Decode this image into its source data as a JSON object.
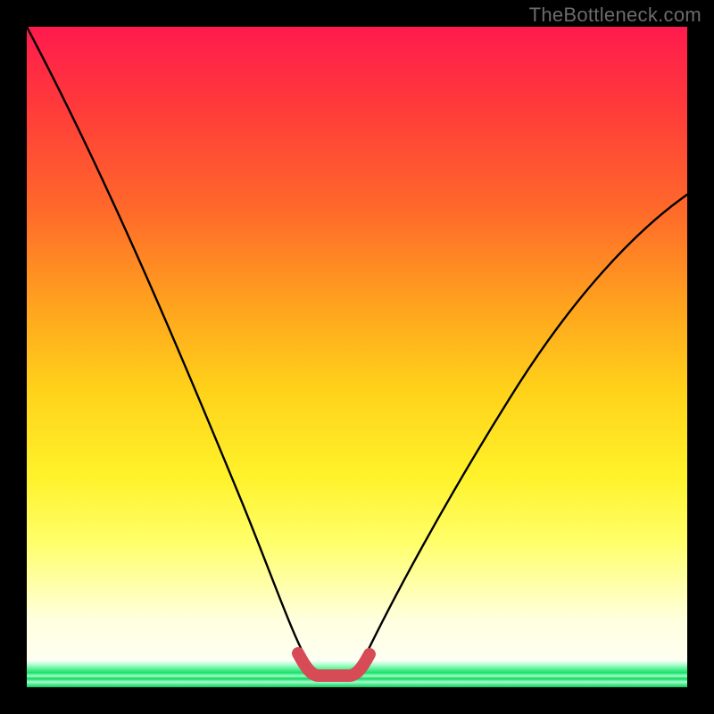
{
  "watermark": "TheBottleneck.com",
  "colors": {
    "frame": "#000000",
    "watermark": "#6b6b6b",
    "curve": "#000000",
    "highlight": "#d64b56",
    "green": "#0bcb5a"
  },
  "chart_data": {
    "type": "line",
    "title": "",
    "xlabel": "",
    "ylabel": "",
    "xlim": [
      0,
      100
    ],
    "ylim": [
      0,
      100
    ],
    "grid": false,
    "legend": false,
    "x": [
      0,
      5,
      10,
      15,
      20,
      25,
      30,
      35,
      38,
      40,
      42,
      45,
      48,
      50,
      55,
      60,
      65,
      70,
      75,
      80,
      85,
      90,
      95,
      100
    ],
    "series": [
      {
        "name": "bottleneck-curve",
        "values": [
          100,
          90,
          80,
          69,
          58,
          47,
          36,
          24,
          14,
          8,
          4,
          1,
          1,
          2,
          8,
          16,
          24,
          31,
          38,
          44,
          50,
          55,
          59,
          63
        ]
      }
    ],
    "highlight_segment": {
      "x": [
        38,
        40,
        42,
        45,
        48,
        50
      ],
      "values": [
        6,
        3,
        1.5,
        1,
        1.5,
        3
      ]
    }
  }
}
